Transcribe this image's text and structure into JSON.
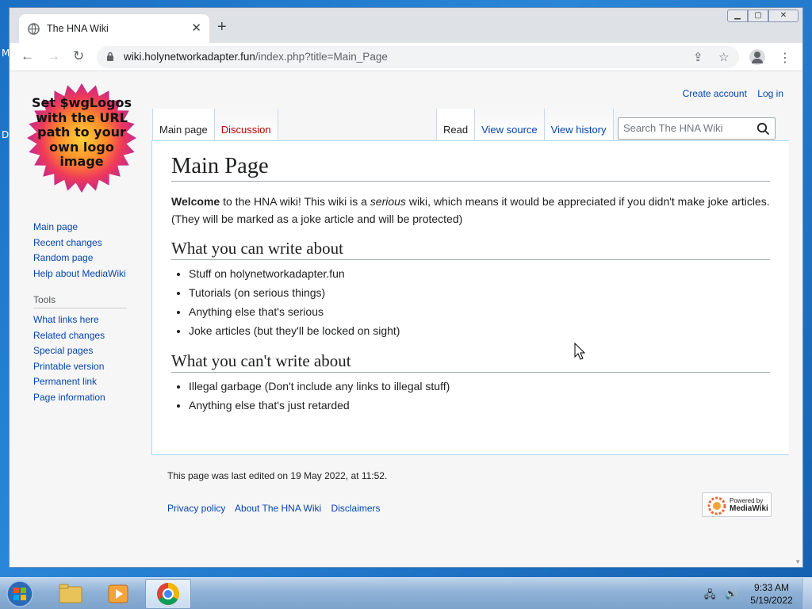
{
  "desktop": {
    "glyph_m": "M",
    "glyph_d": "D"
  },
  "browser": {
    "tab_title": "The HNA Wiki",
    "url_domain": "wiki.holynetworkadapter.fun",
    "url_path": "/index.php?title=Main_Page"
  },
  "wiki": {
    "logo_text": "Set $wgLogos with the URL path to your own logo image",
    "personal": {
      "create_account": "Create account",
      "log_in": "Log in"
    },
    "tabs_left": [
      "Main page",
      "Discussion"
    ],
    "tabs_right": [
      "Read",
      "View source",
      "View history"
    ],
    "search_placeholder": "Search The HNA Wiki",
    "navigation": [
      "Main page",
      "Recent changes",
      "Random page",
      "Help about MediaWiki"
    ],
    "tools_heading": "Tools",
    "tools": [
      "What links here",
      "Related changes",
      "Special pages",
      "Printable version",
      "Permanent link",
      "Page information"
    ],
    "title": "Main Page",
    "intro": {
      "bold": "Welcome",
      "part1": " to the HNA wiki! This wiki is a ",
      "italic": "serious",
      "part2": " wiki, which means it would be appreciated if you didn't make joke articles. (They will be marked as a joke article and will be protected)"
    },
    "section1": {
      "heading": "What you can write about",
      "items": [
        "Stuff on holynetworkadapter.fun",
        "Tutorials (on serious things)",
        "Anything else that's serious",
        "Joke articles (but they'll be locked on sight)"
      ]
    },
    "section2": {
      "heading": "What you can't write about",
      "items": [
        "Illegal garbage (Don't include any links to illegal stuff)",
        "Anything else that's just retarded"
      ]
    },
    "last_edited": "This page was last edited on 19 May 2022, at 11:52.",
    "footer_links": [
      "Privacy policy",
      "About The HNA Wiki",
      "Disclaimers"
    ],
    "powered_small": "Powered by",
    "powered_big": "MediaWiki"
  },
  "taskbar": {
    "time": "9:33 AM",
    "date": "5/19/2022"
  }
}
